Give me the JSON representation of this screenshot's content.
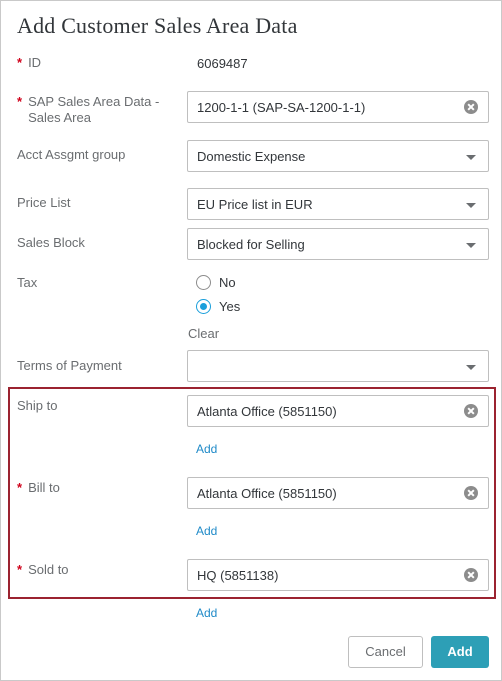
{
  "dialog": {
    "title": "Add Customer Sales Area Data"
  },
  "fields": {
    "id": {
      "required_mark": "*",
      "label": "ID",
      "value": "6069487"
    },
    "sales_area": {
      "required_mark": "*",
      "label": "SAP Sales Area Data - Sales Area",
      "value": "1200-1-1 (SAP-SA-1200-1-1)"
    },
    "acct_assgmt_group": {
      "label": "Acct Assgmt group",
      "value": "Domestic Expense"
    },
    "price_list": {
      "label": "Price List",
      "value": "EU Price list in EUR"
    },
    "sales_block": {
      "label": "Sales Block",
      "value": "Blocked for Selling"
    },
    "tax": {
      "label": "Tax",
      "options": [
        {
          "label": "No",
          "selected": false
        },
        {
          "label": "Yes",
          "selected": true
        }
      ],
      "clear_label": "Clear"
    },
    "terms_of_payment": {
      "label": "Terms of Payment",
      "value": ""
    },
    "ship_to": {
      "label": "Ship to",
      "value": "Atlanta Office (5851150)",
      "add_label": "Add"
    },
    "bill_to": {
      "required_mark": "*",
      "label": "Bill to",
      "value": "Atlanta Office (5851150)",
      "add_label": "Add"
    },
    "sold_to": {
      "required_mark": "*",
      "label": "Sold to",
      "value": "HQ (5851138)",
      "add_label": "Add"
    }
  },
  "footer": {
    "cancel_label": "Cancel",
    "add_label": "Add"
  },
  "colors": {
    "accent": "#2d9fb6",
    "link": "#1f8ac8",
    "required": "#d0021b",
    "highlight_border": "#9b2330",
    "radio_selected": "#1a9fdb"
  }
}
